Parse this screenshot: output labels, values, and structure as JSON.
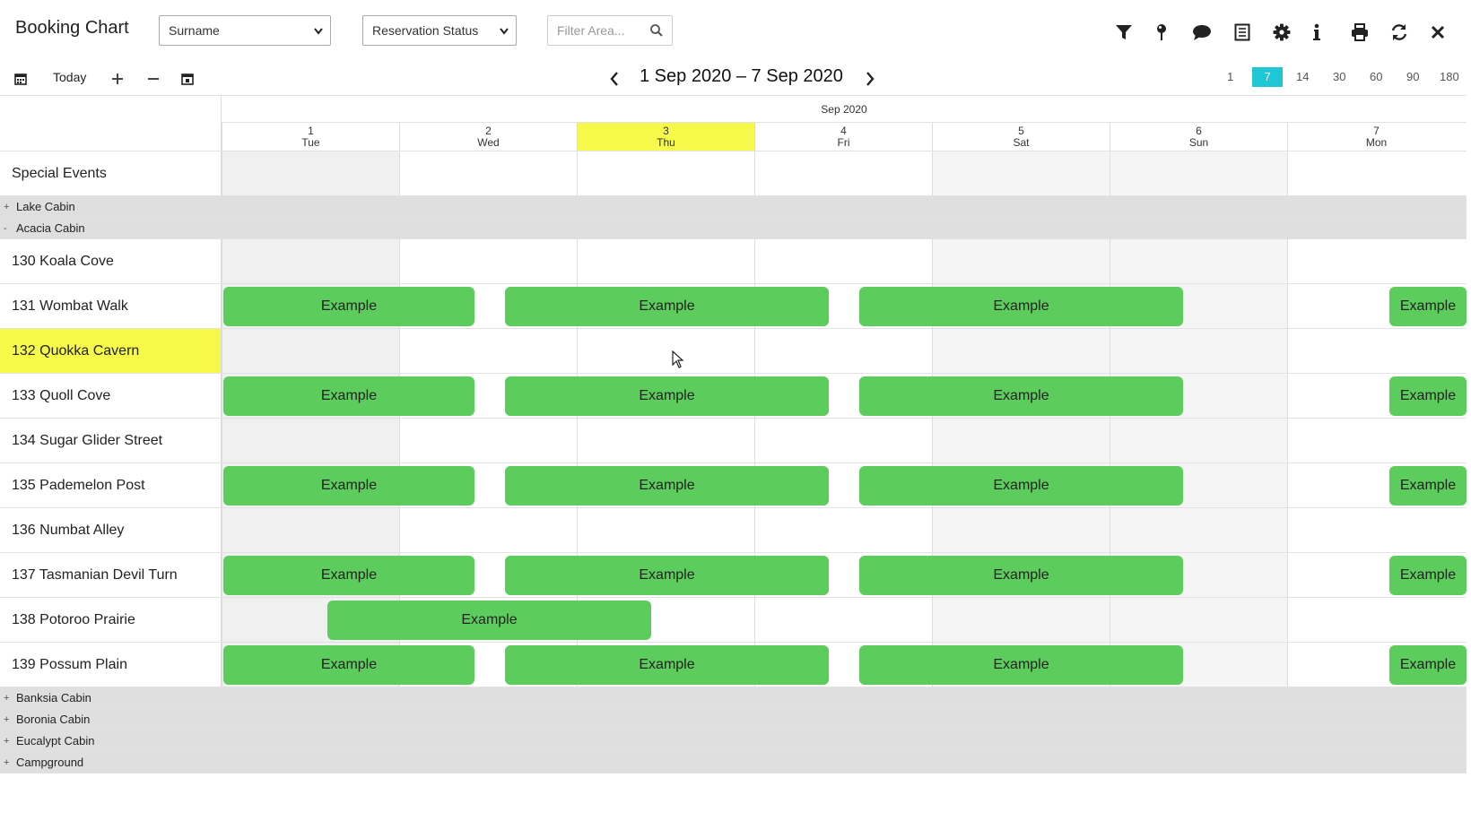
{
  "app": {
    "title": "Booking Chart"
  },
  "toolbar": {
    "sort_select": "Surname",
    "status_select": "Reservation Status",
    "filter_placeholder": "Filter Area...",
    "icons": [
      "filter-icon",
      "pin-icon",
      "chat-icon",
      "receipt-icon",
      "gear-icon",
      "info-icon",
      "print-icon",
      "refresh-icon",
      "close-icon"
    ]
  },
  "subbar": {
    "today_label": "Today",
    "date_range": "1 Sep 2020 – 7 Sep 2020",
    "zoom_options": [
      "1",
      "7",
      "14",
      "30",
      "60",
      "90",
      "180"
    ],
    "zoom_active": "7"
  },
  "calendar": {
    "month": "Sep 2020",
    "days": [
      {
        "num": "1",
        "dow": "Tue"
      },
      {
        "num": "2",
        "dow": "Wed"
      },
      {
        "num": "3",
        "dow": "Thu"
      },
      {
        "num": "4",
        "dow": "Fri"
      },
      {
        "num": "5",
        "dow": "Sat"
      },
      {
        "num": "6",
        "dow": "Sun"
      },
      {
        "num": "7",
        "dow": "Mon"
      }
    ],
    "today_index": 2
  },
  "special_events_label": "Special Events",
  "groups": {
    "lake": {
      "toggle": "+",
      "label": "Lake Cabin"
    },
    "acacia": {
      "toggle": "-",
      "label": "Acacia Cabin"
    },
    "banksia": {
      "toggle": "+",
      "label": "Banksia Cabin"
    },
    "boronia": {
      "toggle": "+",
      "label": "Boronia Cabin"
    },
    "eucalypt": {
      "toggle": "+",
      "label": "Eucalypt Cabin"
    },
    "campground": {
      "toggle": "+",
      "label": "Campground"
    }
  },
  "rooms": [
    {
      "name": "130 Koala Cove"
    },
    {
      "name": "131 Wombat Walk"
    },
    {
      "name": "132 Quokka Cavern"
    },
    {
      "name": "133 Quoll Cove"
    },
    {
      "name": "134 Sugar Glider Street"
    },
    {
      "name": "135 Pademelon Post"
    },
    {
      "name": "136 Numbat Alley"
    },
    {
      "name": "137 Tasmanian Devil Turn"
    },
    {
      "name": "138 Potoroo Prairie"
    },
    {
      "name": "139 Possum Plain"
    }
  ],
  "booking_label": "Example",
  "colors": {
    "booking": "#5ccc5c",
    "today": "#f6f84a",
    "zoom_active": "#1ec6d6"
  }
}
